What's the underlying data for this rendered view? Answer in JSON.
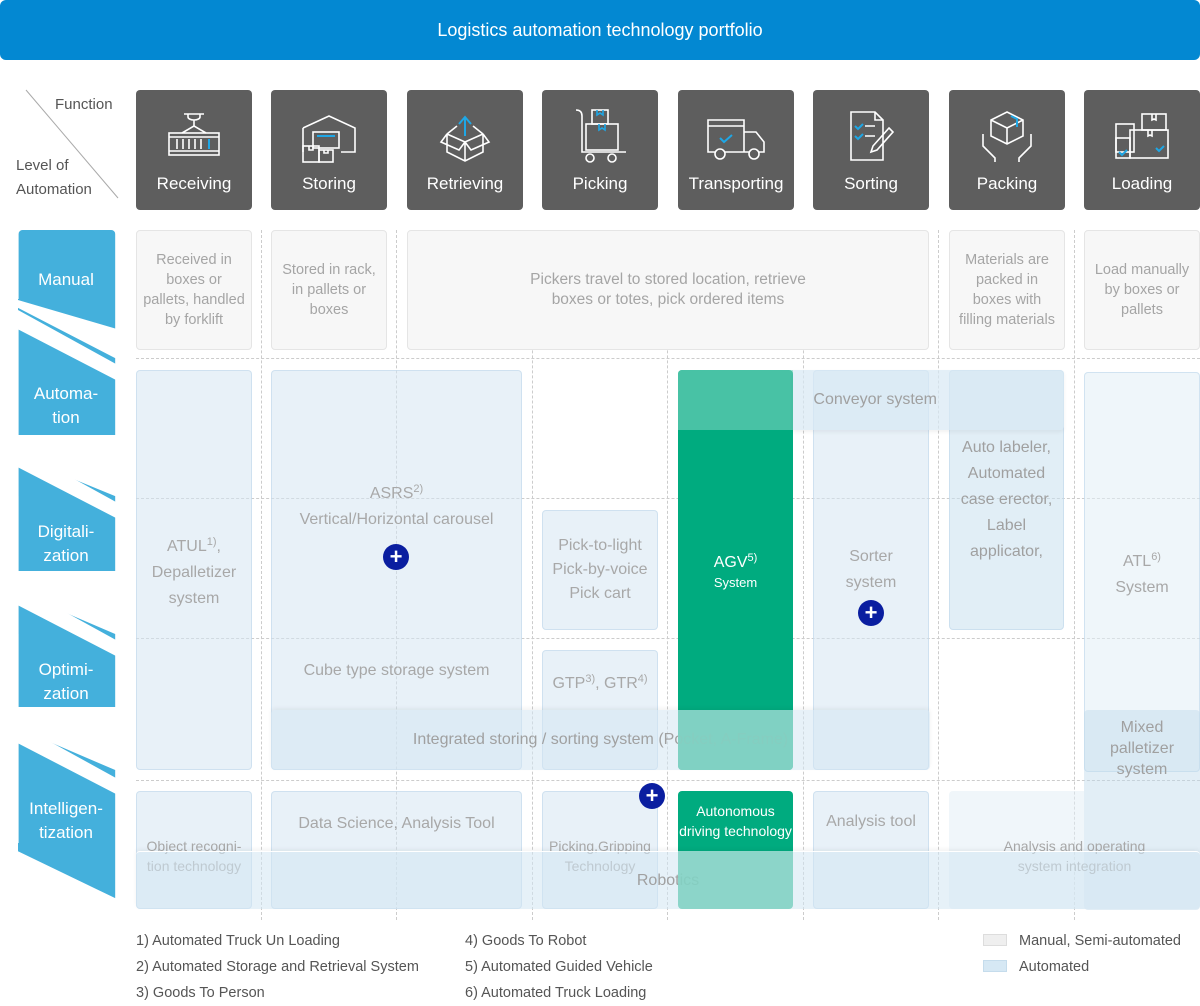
{
  "title": "Logistics automation technology portfolio",
  "corner": {
    "function_label": "Function",
    "level_label_1": "Level of",
    "level_label_2": "Automation"
  },
  "functions": [
    {
      "label": "Receiving",
      "icon": "container-crane-icon"
    },
    {
      "label": "Storing",
      "icon": "warehouse-icon"
    },
    {
      "label": "Retrieving",
      "icon": "open-box-arrow-icon"
    },
    {
      "label": "Picking",
      "icon": "hand-truck-icon"
    },
    {
      "label": "Transporting",
      "icon": "truck-icon"
    },
    {
      "label": "Sorting",
      "icon": "checklist-pencil-icon"
    },
    {
      "label": "Packing",
      "icon": "box-hands-icon"
    },
    {
      "label": "Loading",
      "icon": "stacked-boxes-icon"
    }
  ],
  "levels": [
    {
      "line1": "Manual",
      "line2": ""
    },
    {
      "line1": "Automa-",
      "line2": "tion"
    },
    {
      "line1": "Digitali-",
      "line2": "zation"
    },
    {
      "line1": "Optimi-",
      "line2": "zation"
    },
    {
      "line1": "Intelligen-",
      "line2": "tization"
    }
  ],
  "manual": {
    "receiving": "Received in boxes or pallets, handled by forklift",
    "storing": "Stored in rack, in pallets or boxes",
    "picking_line1": "Pickers  travel to stored location, retrieve",
    "picking_line2": "boxes or totes, pick ordered items",
    "packing": "Materials are packed in boxes with filling materials",
    "loading": "Load manually by boxes or pallets"
  },
  "cells": {
    "atul": "ATUL",
    "atul_sup": "1)",
    "atul_after": ",",
    "depal_1": "Depalletizer",
    "depal_2": "system",
    "asrs": "ASRS",
    "asrs_sup": "2)",
    "carousel": "Vertical/Horizontal carousel",
    "pick_light": "Pick-to-light",
    "pick_voice": "Pick-by-voice",
    "pick_cart": "Pick cart",
    "agv": "AGV",
    "agv_sup": "5)",
    "agv_system": "System",
    "conveyor": "Conveyor system",
    "sorter_1": "Sorter",
    "sorter_2": "system",
    "pack_1": "Auto labeler,",
    "pack_2": "Automated",
    "pack_3": "case erector,",
    "pack_4": "Label",
    "pack_5": "applicator,",
    "atl": "ATL",
    "atl_sup": "6)",
    "atl_system": "System",
    "cube": "Cube type storage system",
    "gtp": "GTP",
    "gtp_sup": "3)",
    "gtr": ", GTR",
    "gtr_sup": "4)",
    "integrated": "Integrated storing / sorting system (Pocket, A-Frame)",
    "mixed_1": "Mixed",
    "mixed_2": "palletizer",
    "mixed_3": "system",
    "object_1": "Object recogni-",
    "object_2": "tion technology",
    "data_science": "Data Science, Analysis Tool",
    "gripping_1": "Picking,Gripping",
    "gripping_2": "Technology",
    "autonomous_1": "Autonomous",
    "autonomous_2": "driving technology",
    "analysis_tool": "Analysis tool",
    "analysis_op_1": "Analysis and operating",
    "analysis_op_2": "system integration",
    "robotics": "Robotics"
  },
  "plus_symbol": "+",
  "footnotes": [
    "1) Automated Truck Un Loading",
    "2) Automated Storage and Retrieval System",
    "3) Goods To Person",
    "4) Goods To Robot",
    "5) Automated Guided Vehicle",
    "6) Automated Truck Loading"
  ],
  "legend": [
    {
      "label": "Manual, Semi-automated",
      "color": "#efefef"
    },
    {
      "label": "Automated",
      "color": "#d6e8f4"
    }
  ],
  "colors": {
    "header": "#0388d2",
    "level": "#44b0dc",
    "function_tile": "#5e5e5e",
    "agv": "#00ab7f",
    "plus": "#0a1ea0",
    "icon_accent": "#1ea7e6"
  }
}
